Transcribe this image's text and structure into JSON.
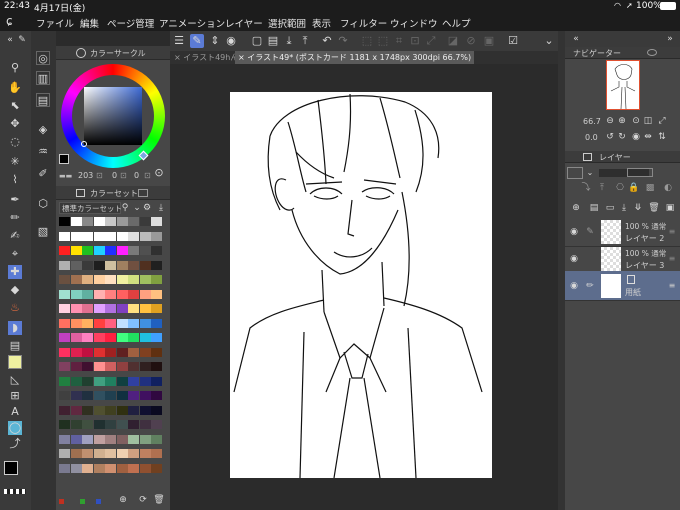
{
  "status": {
    "time": "22:43",
    "date": "4月17日(金)",
    "battery": "100%",
    "icons": [
      "wifi-icon",
      "location-icon",
      "battery-icon"
    ]
  },
  "menu": [
    "ファイル",
    "編集",
    "ページ管理",
    "アニメーション",
    "レイヤー",
    "選択範囲",
    "表示",
    "フィルター",
    "ウィンドウ",
    "ヘルプ"
  ],
  "tabs": [
    {
      "label": "イラスト49hん"
    },
    {
      "label": "イラスト49* (ポストカード 1181 x 1748px 300dpi 66.7%)"
    }
  ],
  "color_circle": {
    "title": "カラーサークル",
    "h": "203",
    "s": "0",
    "v": "0",
    "main_color": "#000000"
  },
  "color_set": {
    "title": "カラーセット",
    "set_name": "標準カラーセット"
  },
  "navigator": {
    "title": "ナビゲーター",
    "zoom": "66.7",
    "rotation": "0.0"
  },
  "layers_panel": {
    "title": "レイヤー"
  },
  "layers": [
    {
      "percent": "100 %",
      "blend": "通常",
      "name": "レイヤー 2"
    },
    {
      "percent": "100 %",
      "blend": "通常",
      "name": "レイヤー 3"
    },
    {
      "percent": "",
      "blend": "",
      "name": "用紙"
    }
  ],
  "colors": {
    "accent": "#5b7bd5",
    "canvas_bg": "#ffffff",
    "app_bg": "#2b2b2b",
    "panel": "#474747"
  },
  "palette_rows": [
    [
      "#000000",
      "#ffffff",
      "#888888",
      "#ffffff",
      "#c8c8c8",
      "#9a9a9a",
      "#6a6a6a",
      "#3a3a3a",
      "#dddddd"
    ],
    [
      "#ffffff",
      "#ffffff",
      "#ffffff",
      "#ffffff",
      "#ffffff",
      "#ffffff",
      "#e0e0e0",
      "#bbbbbb",
      "#999999"
    ],
    [
      "#ff2020",
      "#ffe000",
      "#20c020",
      "#20d0ff",
      "#2030ff",
      "#ff20ff",
      "#7a7a7a",
      "#505050",
      "#303030"
    ],
    [
      "#b0b0b0",
      "#606060",
      "#3a3a3a",
      "#1e1e1e",
      "#d0c0a0",
      "#a08060",
      "#705040",
      "#503020",
      "#202020"
    ],
    [
      "#6a5040",
      "#a07050",
      "#e0b080",
      "#ffd0a0",
      "#ffe0c0",
      "#f0f0a0",
      "#d0e080",
      "#a0c060",
      "#80a040"
    ],
    [
      "#a0e0d0",
      "#80d0c0",
      "#60b0a0",
      "#ffb0b0",
      "#ff8080",
      "#ff6060",
      "#e04040",
      "#ffa080",
      "#ffc080"
    ],
    [
      "#ffd0e0",
      "#ff90b0",
      "#e07090",
      "#e0a0ff",
      "#b070e0",
      "#8040c0",
      "#ffe080",
      "#ffc040",
      "#e0a020"
    ],
    [
      "#ff7060",
      "#ff9060",
      "#ffb060",
      "#ff4040",
      "#ff6080",
      "#c0e0ff",
      "#80c0ff",
      "#4090e0",
      "#2060c0"
    ],
    [
      "#c040c0",
      "#e060a0",
      "#ff80c0",
      "#ff4060",
      "#ff2040",
      "#40ff80",
      "#20e060",
      "#20c0e0",
      "#40a0ff"
    ],
    [
      "#ff3060",
      "#e02050",
      "#c01040",
      "#e03030",
      "#a02020",
      "#602020",
      "#a06040",
      "#804020",
      "#603010"
    ],
    [
      "#804060",
      "#602040",
      "#401030",
      "#ff9090",
      "#d06060",
      "#904040",
      "#503030",
      "#302020",
      "#201010"
    ],
    [
      "#208040",
      "#206040",
      "#204030",
      "#40a080",
      "#208060",
      "#104040",
      "#3040a0",
      "#203080",
      "#102060"
    ],
    [
      "#404040",
      "#303050",
      "#203040",
      "#305060",
      "#204050",
      "#103040",
      "#502080",
      "#401060",
      "#300840"
    ],
    [
      "#402030",
      "#602840",
      "#303020",
      "#505030",
      "#404020",
      "#303010",
      "#202040",
      "#101030",
      "#0a0a20"
    ],
    [
      "#203020",
      "#304030",
      "#405040",
      "#203030",
      "#304040",
      "#405050",
      "#302030",
      "#403040",
      "#504050"
    ],
    [
      "#8080a0",
      "#6060a0",
      "#a0a0c0",
      "#c0a0a0",
      "#a08080",
      "#806060",
      "#a0c0a0",
      "#80a080",
      "#608060"
    ],
    [
      "#b0b0b0",
      "#a07050",
      "#c09070",
      "#d0b090",
      "#e0c0a0",
      "#f0d0b0",
      "#d0a080",
      "#c08060",
      "#b07050"
    ],
    [
      "#7a7a90",
      "#9090a0",
      "#e0b090",
      "#b08060",
      "#d09070",
      "#a06040",
      "#c07050",
      "#905030",
      "#704020"
    ]
  ]
}
